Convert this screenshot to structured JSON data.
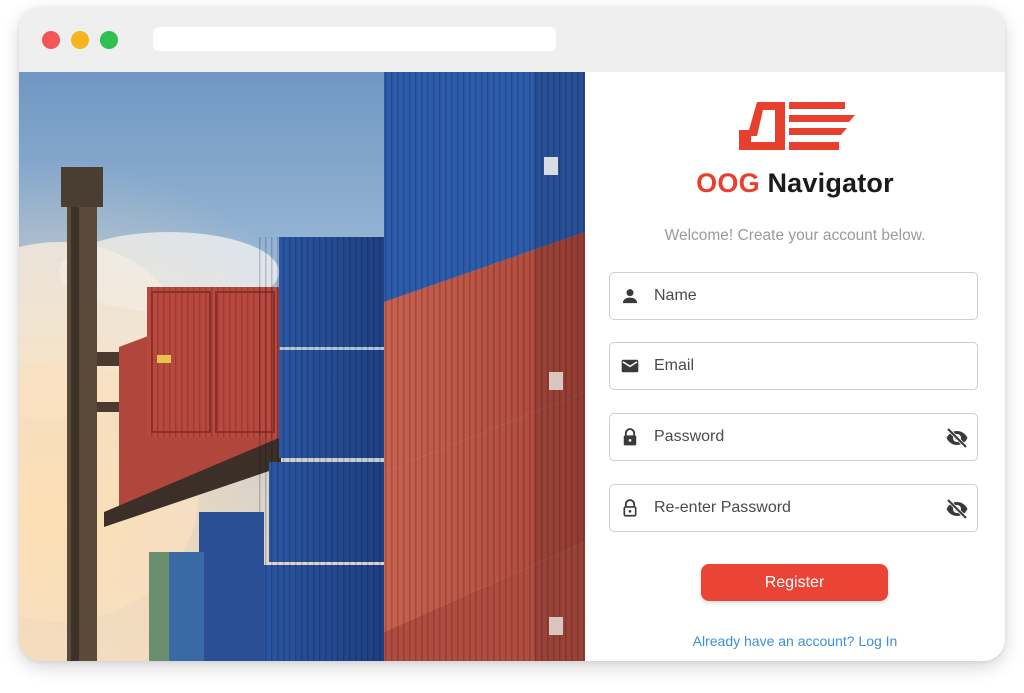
{
  "window": {
    "traffic_lights": [
      "red",
      "yellow",
      "green"
    ],
    "url": ""
  },
  "hero": {
    "description": "Stacked shipping containers at a port with a crane",
    "image": "photo-icon"
  },
  "brand": {
    "name_accent": "OOG",
    "name_rest": " Navigator",
    "accent_color": "#e8402f",
    "logo_icon": "truck-lines-icon"
  },
  "form": {
    "subtitle": "Welcome! Create your account below.",
    "name": {
      "placeholder": "Name",
      "value": "",
      "icon": "person-icon"
    },
    "email": {
      "placeholder": "Email",
      "value": "",
      "icon": "mail-icon"
    },
    "password": {
      "placeholder": "Password",
      "value": "",
      "icon": "lock-icon",
      "toggle_icon": "eye-off-icon"
    },
    "confirm_password": {
      "placeholder": "Re-enter Password",
      "value": "",
      "icon": "lock-outline-icon",
      "toggle_icon": "eye-off-icon"
    },
    "register_label": "Register",
    "login_link": "Already have an account? Log In"
  },
  "colors": {
    "primary": "#ea4436",
    "link": "#3b8fd9",
    "muted_text": "#9a9a9a"
  }
}
